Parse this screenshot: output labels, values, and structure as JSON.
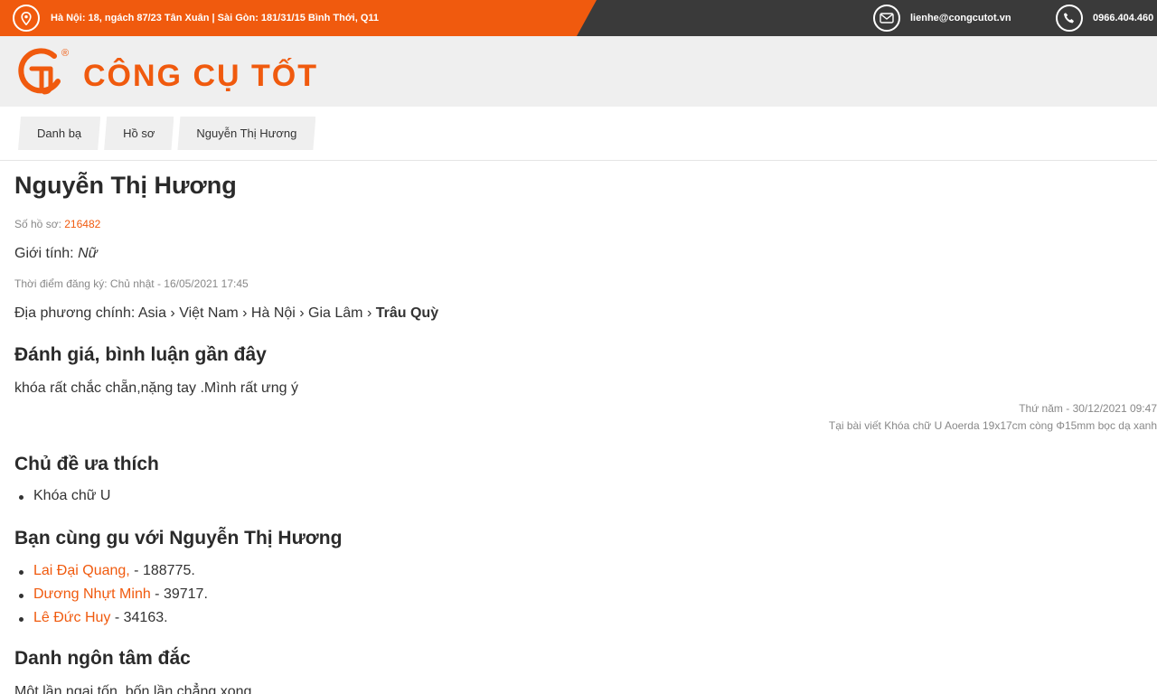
{
  "topbar": {
    "address": "Hà Nội: 18, ngách 87/23 Tân Xuân | Sài Gòn: 181/31/15 Bình Thới, Q11",
    "email": "lienhe@congcutot.vn",
    "phone": "0966.404.460",
    "icons": {
      "location": "location-pin-icon",
      "email": "envelope-icon",
      "phone": "phone-icon"
    }
  },
  "logo": {
    "text": "CÔNG CỤ TỐT",
    "registered": "®",
    "monogram": "CT"
  },
  "breadcrumb": [
    "Danh bạ",
    "Hồ sơ",
    "Nguyễn Thị Hương"
  ],
  "profile": {
    "name": "Nguyễn Thị Hương",
    "id_label": "Số hồ sơ:",
    "id_value": "216482",
    "gender_label": "Giới tính:",
    "gender_value": "Nữ",
    "registered": "Thời điểm đăng ký: Chủ nhật - 16/05/2021 17:45",
    "location_prefix": "Địa phương chính: Asia › Việt Nam › Hà Nội › Gia Lâm › ",
    "location_last": "Trâu Quỳ"
  },
  "reviews": {
    "title": "Đánh giá, bình luận gần đây",
    "items": [
      {
        "text": "khóa rất chắc chẵn,nặng tay .Mình rất ưng ý",
        "date": "Thứ năm - 30/12/2021 09:47",
        "post": "Tại bài viết Khóa chữ U Aoerda 19x17cm còng Φ15mm bọc dạ xanh"
      }
    ]
  },
  "topics": {
    "title": "Chủ đề ưa thích",
    "items": [
      "Khóa chữ U"
    ]
  },
  "friends": {
    "title": "Bạn cùng gu với Nguyễn Thị Hương",
    "items": [
      {
        "name": "Lai Đại Quang,",
        "suffix": " - 188775."
      },
      {
        "name": "Dương Nhựt Minh",
        "suffix": " - 39717."
      },
      {
        "name": "Lê Đức Huy",
        "suffix": " - 34163."
      }
    ]
  },
  "quotes": {
    "title": "Danh ngôn tâm đắc",
    "text": "Một lần ngại tốn, bốn lần chẳng xong."
  },
  "colors": {
    "accent": "#f05a0e",
    "topbar_dark": "#3a3a3a",
    "header_bg": "#efefef"
  }
}
